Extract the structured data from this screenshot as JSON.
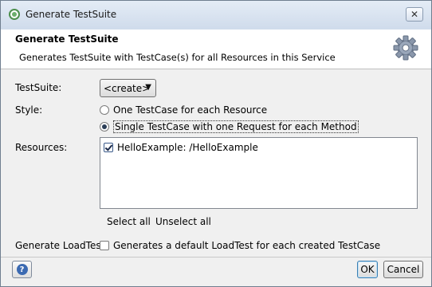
{
  "window": {
    "title": "Generate TestSuite",
    "close_symbol": "✕"
  },
  "header": {
    "title": "Generate TestSuite",
    "description": "Generates TestSuite with TestCase(s) for all Resources in this Service",
    "icon": "gear-icon"
  },
  "form": {
    "testsuite_label": "TestSuite:",
    "testsuite_value": "<create>",
    "style_label": "Style:",
    "style_options": [
      {
        "label": "One TestCase for each Resource",
        "selected": false
      },
      {
        "label": "Single TestCase with one Request for each Method",
        "selected": true
      }
    ],
    "resources_label": "Resources:",
    "resources": [
      {
        "label": "HelloExample: /HelloExample",
        "checked": true
      }
    ],
    "select_all": "Select all",
    "unselect_all": "Unselect all",
    "loadtest_label": "Generate LoadTest:",
    "loadtest_option": "Generates a default LoadTest for each created TestCase",
    "loadtest_checked": false
  },
  "footer": {
    "help_symbol": "?",
    "ok": "OK",
    "cancel": "Cancel"
  }
}
